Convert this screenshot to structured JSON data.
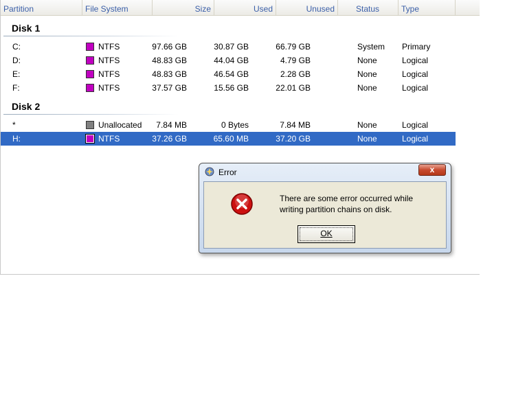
{
  "columns": {
    "partition": "Partition",
    "file_system": "File System",
    "size": "Size",
    "used": "Used",
    "unused": "Unused",
    "status": "Status",
    "type": "Type"
  },
  "disk1": {
    "label": "Disk 1",
    "rows": [
      {
        "partition": "C:",
        "fs": "NTFS",
        "size": "97.66 GB",
        "used": "30.87 GB",
        "unused": "66.79 GB",
        "status": "System",
        "type": "Primary"
      },
      {
        "partition": "D:",
        "fs": "NTFS",
        "size": "48.83 GB",
        "used": "44.04 GB",
        "unused": "4.79 GB",
        "status": "None",
        "type": "Logical"
      },
      {
        "partition": "E:",
        "fs": "NTFS",
        "size": "48.83 GB",
        "used": "46.54 GB",
        "unused": "2.28 GB",
        "status": "None",
        "type": "Logical"
      },
      {
        "partition": "F:",
        "fs": "NTFS",
        "size": "37.57 GB",
        "used": "15.56 GB",
        "unused": "22.01 GB",
        "status": "None",
        "type": "Logical"
      }
    ]
  },
  "disk2": {
    "label": "Disk 2",
    "rows": [
      {
        "partition": "*",
        "fs": "Unallocated",
        "size": "7.84 MB",
        "used": "0 Bytes",
        "unused": "7.84 MB",
        "status": "None",
        "type": "Logical"
      },
      {
        "partition": "H:",
        "fs": "NTFS",
        "size": "37.26 GB",
        "used": "65.60 MB",
        "unused": "37.20 GB",
        "status": "None",
        "type": "Logical"
      }
    ]
  },
  "colors": {
    "ntfs": "#c000c0",
    "unallocated": "#808080",
    "selection": "#316ac5"
  },
  "dialog": {
    "title": "Error",
    "close_label": "x",
    "message_line1": "There are some error occurred while",
    "message_line2": "writing partition chains on disk.",
    "ok_label": "OK",
    "icon": "error-icon"
  }
}
